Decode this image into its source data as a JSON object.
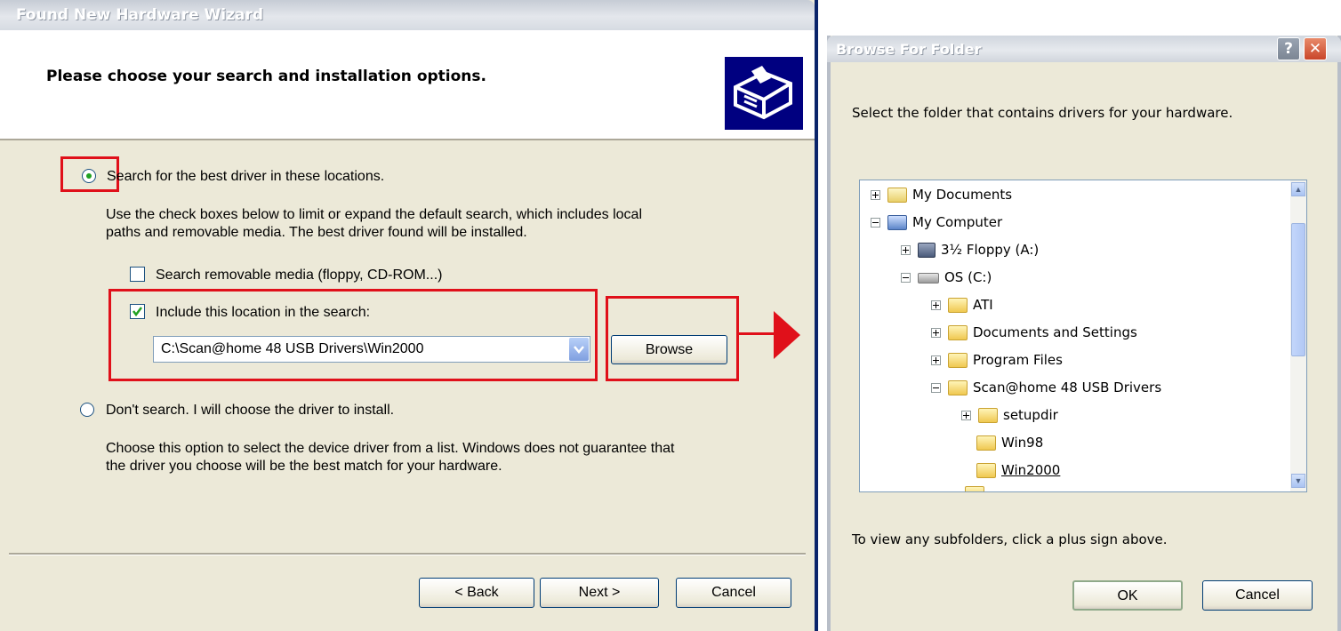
{
  "wizard": {
    "title": "Found New Hardware Wizard",
    "heading": "Please choose your search and installation options.",
    "option_search_label": "Search for the best driver in these locations.",
    "option_search_desc_line1": "Use the check boxes below to limit or expand the default search, which includes local",
    "option_search_desc_line2": "paths and removable media. The best driver found will be installed.",
    "check_removable_label": "Search removable media (floppy, CD-ROM...)",
    "check_removable_checked": false,
    "check_include_label": "Include this location in the search:",
    "check_include_checked": true,
    "location_value": "C:\\Scan@home 48 USB Drivers\\Win2000",
    "browse_label": "Browse",
    "option_dont_search_label": "Don't search. I will choose the driver to install.",
    "option_dont_search_desc_line1": "Choose this option to select the device driver from a list.  Windows does not guarantee that",
    "option_dont_search_desc_line2": "the driver you choose will be the best match for your hardware.",
    "back_label": "< Back",
    "next_label": "Next >",
    "cancel_label": "Cancel"
  },
  "browse_dialog": {
    "title": "Browse For Folder",
    "help_glyph": "?",
    "close_glyph": "✕",
    "instruction": "Select the folder that contains drivers for your hardware.",
    "tree": [
      {
        "label": "My Documents",
        "icon": "documents-folder-icon",
        "expander": "+"
      },
      {
        "label": "My Computer",
        "icon": "computer-icon",
        "expander": "-"
      },
      {
        "label": "3½ Floppy (A:)",
        "icon": "floppy-drive-icon",
        "expander": "+"
      },
      {
        "label": "OS (C:)",
        "icon": "hard-drive-icon",
        "expander": "-"
      },
      {
        "label": "ATI",
        "icon": "folder-icon",
        "expander": "+"
      },
      {
        "label": "Documents and Settings",
        "icon": "folder-icon",
        "expander": "+"
      },
      {
        "label": "Program Files",
        "icon": "folder-icon",
        "expander": "+"
      },
      {
        "label": "Scan@home 48 USB Drivers",
        "icon": "folder-icon",
        "expander": "-"
      },
      {
        "label": "setupdir",
        "icon": "folder-icon",
        "expander": "+"
      },
      {
        "label": "Win98",
        "icon": "folder-icon",
        "expander": ""
      },
      {
        "label": "Win2000",
        "icon": "open-folder-icon",
        "expander": "",
        "selected": true
      }
    ],
    "hint": "To view any subfolders, click a plus sign above.",
    "ok_label": "OK",
    "cancel_label": "Cancel"
  },
  "colors": {
    "annotation_red": "#e0101a",
    "xp_face": "#ece9d8",
    "title_text": "#ffffff"
  }
}
